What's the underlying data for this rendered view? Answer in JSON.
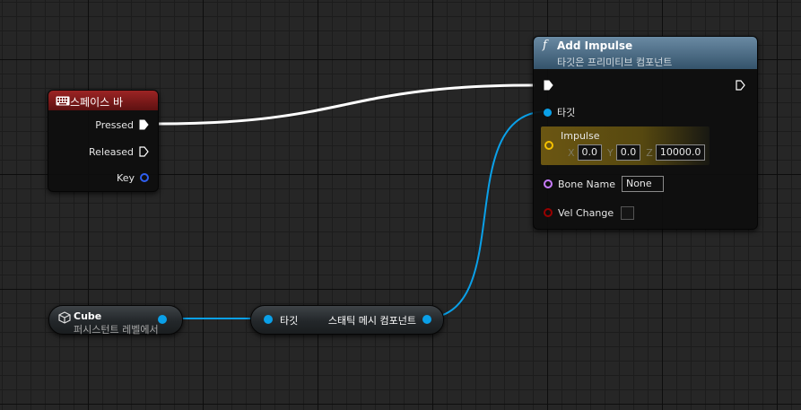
{
  "nodes": {
    "spacebar": {
      "title": "스페이스 바",
      "header_color": "#8a1c1c",
      "pins": {
        "pressed": "Pressed",
        "released": "Released",
        "key": "Key"
      }
    },
    "add_impulse": {
      "function_symbol": "f",
      "title": "Add Impulse",
      "subtitle": "타깃은 프리미티브 컴포넌트",
      "header_color": "#4c6d87",
      "target_label": "타깃",
      "impulse_label": "Impulse",
      "impulse": {
        "x_label": "X",
        "x": "0.0",
        "y_label": "Y",
        "y": "0.0",
        "z_label": "Z",
        "z": "10000.0"
      },
      "bone_name_label": "Bone Name",
      "bone_name_value": "None",
      "vel_change_label": "Vel Change"
    },
    "cube": {
      "title": "Cube",
      "subtitle": "퍼시스턴트 레벨에서"
    },
    "cast": {
      "input_label": "타깃",
      "output_label": "스태틱 메시 컴포넌트"
    }
  },
  "colors": {
    "object_pin": "#0aa0e8",
    "vector_pin": "#f5c100",
    "name_pin": "#c87cff",
    "bool_pin": "#990000",
    "key_pin": "#2f5ff0",
    "exec_wire": "#ffffff"
  },
  "icons": {
    "keyboard": "keyboard-icon",
    "cube": "cube-icon",
    "function": "function-icon"
  }
}
